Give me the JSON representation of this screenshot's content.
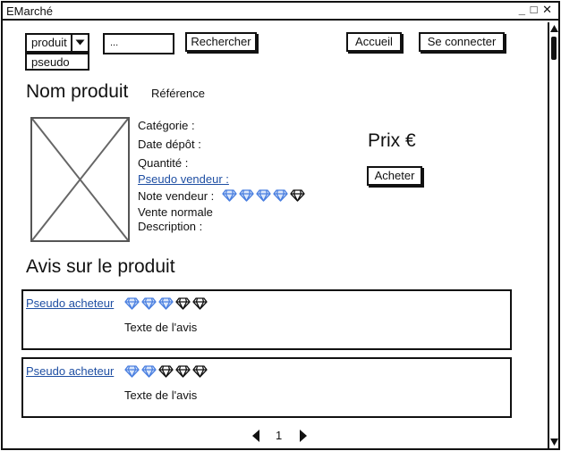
{
  "window": {
    "title": "EMarché",
    "controls": [
      "_",
      "□",
      "✕"
    ]
  },
  "header": {
    "filter": {
      "selected": "produit",
      "options": [
        "pseudo"
      ]
    },
    "search": {
      "value": "..."
    },
    "search_button": "Rechercher",
    "home_button": "Accueil",
    "login_button": "Se connecter"
  },
  "product": {
    "name": "Nom produit",
    "reference": "Référence",
    "category_label": "Catégorie :",
    "date_label": "Date dépôt :",
    "quantity_label": "Quantité :",
    "seller_label": "Pseudo vendeur :",
    "rating_label": "Note vendeur :",
    "seller_rating": 4,
    "sale_type": "Vente normale",
    "description_label": "Description :",
    "price": "Prix €",
    "buy_button": "Acheter"
  },
  "reviews": {
    "title": "Avis sur le produit",
    "items": [
      {
        "author": "Pseudo acheteur",
        "rating": 3,
        "text": "Texte de l'avis"
      },
      {
        "author": "Pseudo acheteur",
        "rating": 2,
        "text": "Texte de l'avis"
      }
    ]
  },
  "pagination": {
    "current": "1"
  },
  "colors": {
    "filled_gem": "#4a7fe0",
    "empty_gem": "#111111",
    "link": "#1f4fa3"
  },
  "icons": {
    "gem": "diamond-icon",
    "prev": "triangle-left-icon",
    "next": "triangle-right-icon"
  }
}
